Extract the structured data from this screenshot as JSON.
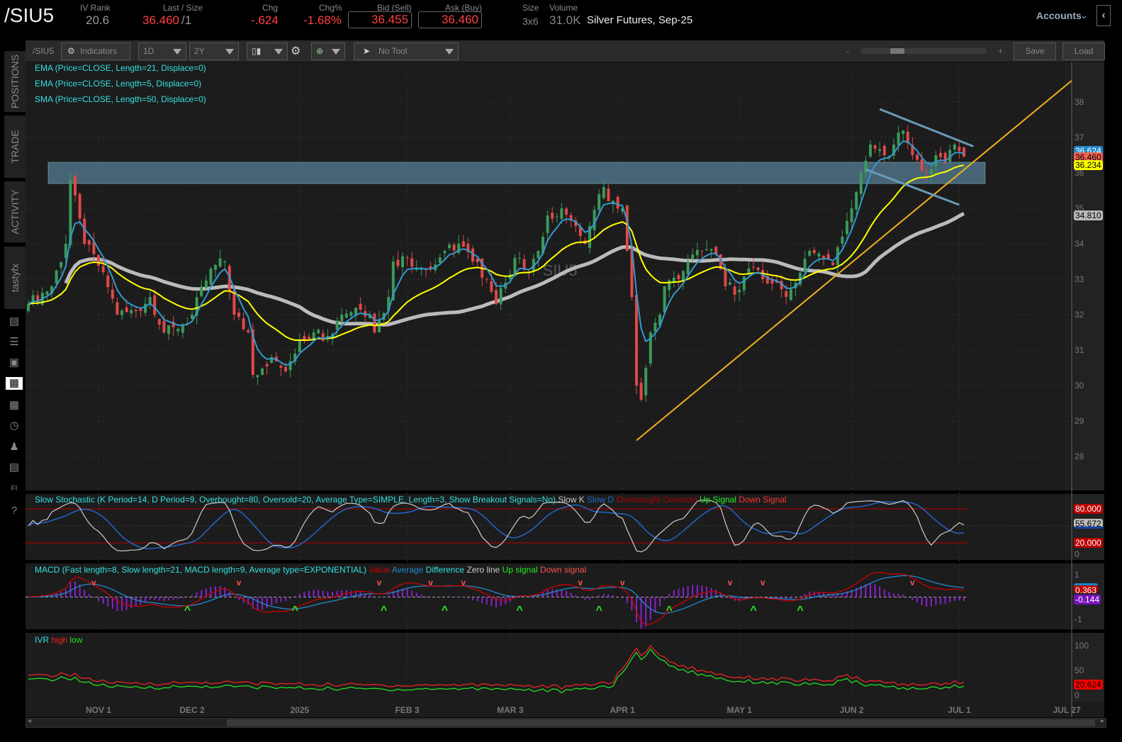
{
  "header": {
    "symbol": "/SIU5",
    "iv_rank_label": "IV Rank",
    "iv_rank": "20.6",
    "last_label": "Last / Size",
    "last": "36.460",
    "size_sep": "/1",
    "chg_label": "Chg",
    "chg": "-.624",
    "chgpct_label": "Chg%",
    "chgpct": "-1.68%",
    "bid_label": "Bid (Sell)",
    "bid": "36.455",
    "ask_label": "Ask (Buy)",
    "ask": "36.460",
    "sz_label": "Size",
    "sz": "3x6",
    "vol_label": "Volume",
    "vol": "31.0K",
    "desc": "Silver Futures, Sep-25",
    "accounts": "Accounts"
  },
  "toolbar": {
    "symbol": "/SIU5",
    "indicators": "Indicators",
    "interval": "1D",
    "range": "2Y",
    "tool": "No Tool",
    "minus": "-",
    "plus": "+",
    "save": "Save",
    "load": "Load",
    "zoom_fraction": 0.2
  },
  "sidebar": {
    "tabs": [
      "POSITIONS",
      "TRADE",
      "ACTIVITY",
      "tastyfx"
    ]
  },
  "studies": {
    "ema21": "EMA (Price=CLOSE, Length=21, Displace=0)",
    "ema5": "EMA (Price=CLOSE, Length=5, Displace=0)",
    "sma50": "SMA (Price=CLOSE, Length=50, Displace=0)",
    "stoch": "Slow Stochastic (K Period=14, D Period=9, Overbought=80, Oversold=20, Average Type=SIMPLE, Length=3, Show Breakout Signals=No)",
    "stoch_legend": [
      "Slow K",
      "Slow D",
      "Overbought",
      "Oversold",
      "Up Signal",
      "Down Signal"
    ],
    "macd": "MACD (Fast length=8, Slow length=21, MACD length=9, Average type=EXPONENTIAL)",
    "macd_legend": [
      "Value",
      "Average",
      "Difference",
      "Zero line",
      "Up signal",
      "Down signal"
    ],
    "ivr": "IVR",
    "ivr_legend": [
      "high",
      "low"
    ]
  },
  "watermark": "SIU5",
  "tags": {
    "ema5": "36.624",
    "last": "36.460",
    "ema21": "36.234",
    "sma50": "34.810",
    "ob": "80.000",
    "slowk": "55.672",
    "os": "20.000",
    "macd_val": "0.363",
    "macd_diff": "-0.144",
    "ivr": "20.624"
  },
  "colors": {
    "up": "#3a9a5a",
    "down": "#e04848",
    "ema5": "#3399d0",
    "ema21": "#ffff00",
    "sma50": "#bbbbbb",
    "trend": "#f0b020",
    "zone": "#6aa0c0"
  },
  "chart_data": {
    "type": "candlestick",
    "price_axis": {
      "ticks": [
        "38",
        "37",
        "36",
        "35",
        "34",
        "33",
        "32",
        "31",
        "30",
        "29",
        "28"
      ],
      "range": [
        27.7,
        39
      ]
    },
    "date_labels": [
      {
        "day": 15,
        "label": "NOV 1"
      },
      {
        "day": 35,
        "label": "DEC 2"
      },
      {
        "day": 58,
        "label": "2025"
      },
      {
        "day": 81,
        "label": "FEB 3"
      },
      {
        "day": 103,
        "label": "MAR 3"
      },
      {
        "day": 127,
        "label": "APR 1"
      },
      {
        "day": 152,
        "label": "MAY 1"
      },
      {
        "day": 176,
        "label": "JUN 2"
      },
      {
        "day": 199,
        "label": "JUL 1"
      },
      {
        "day": 222,
        "label": "JUL 27"
      }
    ],
    "close_anchors": [
      [
        0,
        32.3
      ],
      [
        5,
        32.8
      ],
      [
        8,
        34
      ],
      [
        9,
        35.8
      ],
      [
        12,
        34
      ],
      [
        16,
        33.2
      ],
      [
        19,
        32
      ],
      [
        23,
        32.1
      ],
      [
        26,
        32.5
      ],
      [
        29,
        31.5
      ],
      [
        32,
        31.6
      ],
      [
        35,
        32
      ],
      [
        39,
        33.3
      ],
      [
        42,
        33.5
      ],
      [
        44,
        32
      ],
      [
        47,
        31.5
      ],
      [
        48,
        30.3
      ],
      [
        52,
        30.8
      ],
      [
        55,
        30.4
      ],
      [
        58,
        31.3
      ],
      [
        61,
        31.5
      ],
      [
        64,
        31.4
      ],
      [
        67,
        32
      ],
      [
        70,
        32.2
      ],
      [
        73,
        32
      ],
      [
        74,
        31.5
      ],
      [
        77,
        32.5
      ],
      [
        78,
        33.5
      ],
      [
        81,
        33.6
      ],
      [
        84,
        33.3
      ],
      [
        86,
        33.3
      ],
      [
        89,
        33.8
      ],
      [
        92,
        34
      ],
      [
        95,
        33.5
      ],
      [
        98,
        33
      ],
      [
        100,
        32.3
      ],
      [
        102,
        32.9
      ],
      [
        104,
        33.6
      ],
      [
        107,
        33.2
      ],
      [
        109,
        33.8
      ],
      [
        111,
        34.8
      ],
      [
        114,
        35
      ],
      [
        117,
        34.5
      ],
      [
        119,
        34
      ],
      [
        120,
        34.5
      ],
      [
        123,
        35.6
      ],
      [
        124,
        35.2
      ],
      [
        127,
        35
      ],
      [
        128,
        33.8
      ],
      [
        129,
        32.5
      ],
      [
        130,
        30
      ],
      [
        131,
        29.6
      ],
      [
        132,
        30.5
      ],
      [
        133,
        31.5
      ],
      [
        135,
        32
      ],
      [
        136,
        32.8
      ],
      [
        139,
        33
      ],
      [
        141,
        33.5
      ],
      [
        144,
        33.8
      ],
      [
        147,
        33.7
      ],
      [
        149,
        32.8
      ],
      [
        152,
        32.7
      ],
      [
        154,
        33.3
      ],
      [
        157,
        33
      ],
      [
        160,
        32.9
      ],
      [
        162,
        32.5
      ],
      [
        164,
        32.9
      ],
      [
        167,
        33.8
      ],
      [
        170,
        33.6
      ],
      [
        172,
        33.4
      ],
      [
        174,
        34.2
      ],
      [
        176,
        35
      ],
      [
        178,
        36
      ],
      [
        180,
        36.8
      ],
      [
        183,
        36.5
      ],
      [
        185,
        36.8
      ],
      [
        187,
        37.2
      ],
      [
        189,
        36.5
      ],
      [
        192,
        36
      ],
      [
        194,
        36.5
      ],
      [
        196,
        36.3
      ],
      [
        198,
        36.8
      ],
      [
        200,
        36.46
      ]
    ],
    "resistance_zone": [
      35.7,
      36.3
    ],
    "trendline": [
      [
        130,
        28.45
      ],
      [
        223,
        38.6
      ]
    ],
    "channel_upper": [
      [
        182,
        37.8
      ],
      [
        202,
        36.75
      ]
    ],
    "channel_lower": [
      [
        179,
        36.1
      ],
      [
        199,
        35.1
      ]
    ],
    "stoch_axis": [
      "80.000",
      "20.000",
      "0"
    ],
    "macd_axis": [
      "1",
      "-1"
    ],
    "ivr_axis": [
      "100",
      "50",
      "0"
    ],
    "ivr_anchors": [
      [
        0,
        30
      ],
      [
        10,
        35
      ],
      [
        12,
        25
      ],
      [
        20,
        15
      ],
      [
        40,
        18
      ],
      [
        60,
        14
      ],
      [
        80,
        12
      ],
      [
        100,
        14
      ],
      [
        115,
        8
      ],
      [
        125,
        20
      ],
      [
        128,
        60
      ],
      [
        130,
        85
      ],
      [
        131,
        70
      ],
      [
        133,
        95
      ],
      [
        135,
        70
      ],
      [
        140,
        50
      ],
      [
        145,
        40
      ],
      [
        150,
        30
      ],
      [
        160,
        25
      ],
      [
        170,
        20
      ],
      [
        175,
        30
      ],
      [
        180,
        20
      ],
      [
        190,
        12
      ],
      [
        200,
        20
      ]
    ]
  }
}
